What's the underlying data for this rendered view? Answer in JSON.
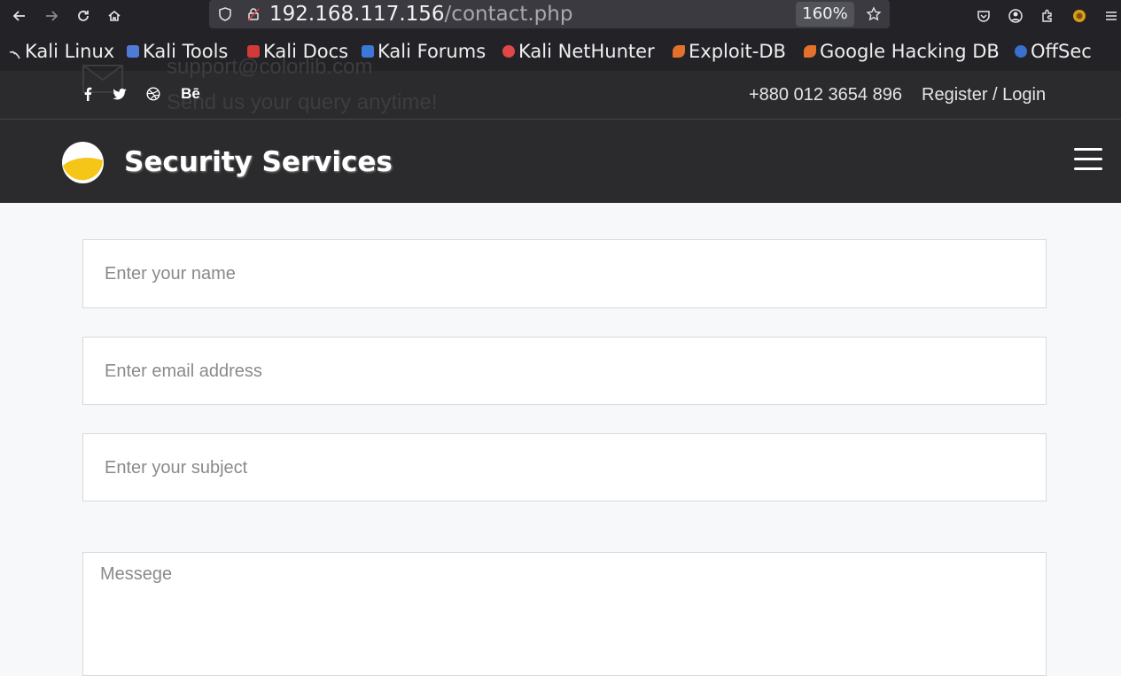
{
  "browser": {
    "url_host": "192.168.117.156",
    "url_path": "/contact.php",
    "zoom": "160%",
    "bookmarks": [
      {
        "label": "Kali Linux",
        "icon": "kali-dragon-icon"
      },
      {
        "label": "Kali Tools",
        "icon": "kali-tools-icon"
      },
      {
        "label": "Kali Docs",
        "icon": "kali-docs-icon"
      },
      {
        "label": "Kali Forums",
        "icon": "kali-forums-icon"
      },
      {
        "label": "Kali NetHunter",
        "icon": "kali-nethunter-icon"
      },
      {
        "label": "Exploit-DB",
        "icon": "exploit-db-icon"
      },
      {
        "label": "Google Hacking DB",
        "icon": "ghdb-icon"
      },
      {
        "label": "OffSec",
        "icon": "offsec-icon"
      }
    ]
  },
  "topbar": {
    "ghost_email": "support@colorlib.com",
    "ghost_query": "Send us your query anytime!",
    "social_behance": "Bē",
    "phone": "+880 012 3654 896",
    "auth_link": "Register / Login"
  },
  "header": {
    "brand": "Security Services"
  },
  "form": {
    "name_placeholder": "Enter your name",
    "email_placeholder": "Enter email address",
    "subject_placeholder": "Enter your subject",
    "message_placeholder": "Messege"
  },
  "colors": {
    "chrome_bg": "#232327",
    "site_bar_bg": "#2b2b2d",
    "page_bg": "#f7f8fa",
    "logo_yellow": "#f5c518"
  }
}
